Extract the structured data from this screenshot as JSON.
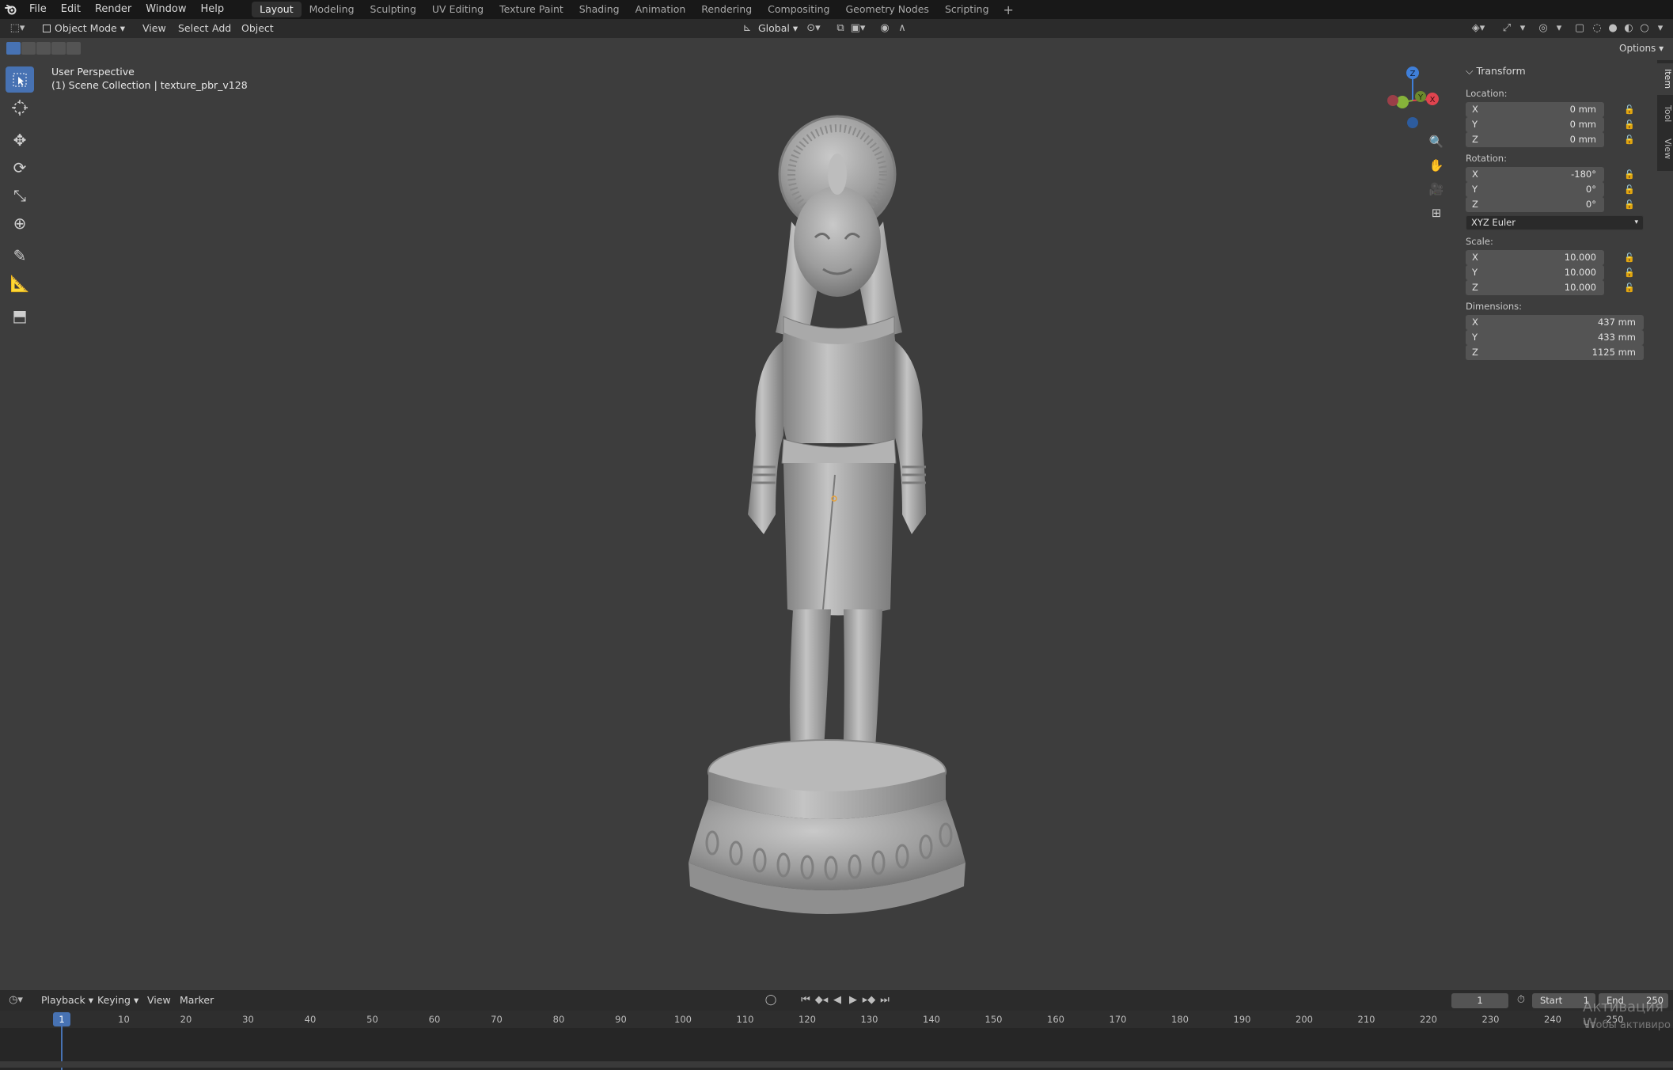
{
  "menu": {
    "items": [
      "File",
      "Edit",
      "Render",
      "Window",
      "Help"
    ]
  },
  "workspaces": {
    "tabs": [
      "Layout",
      "Modeling",
      "Sculpting",
      "UV Editing",
      "Texture Paint",
      "Shading",
      "Animation",
      "Rendering",
      "Compositing",
      "Geometry Nodes",
      "Scripting"
    ],
    "active": "Layout"
  },
  "header": {
    "mode": "Object Mode",
    "menus": [
      "View",
      "Select",
      "Add",
      "Object"
    ],
    "orientation": "Global",
    "options_label": "Options"
  },
  "viewport": {
    "view_name": "User Perspective",
    "collection": "(1) Scene Collection | texture_pbr_v128"
  },
  "gizmo": {
    "axes": [
      "Z",
      "Y",
      "X"
    ]
  },
  "npanel": {
    "section": "Transform",
    "location_label": "Location:",
    "location": [
      {
        "axis": "X",
        "value": "0 mm"
      },
      {
        "axis": "Y",
        "value": "0 mm"
      },
      {
        "axis": "Z",
        "value": "0 mm"
      }
    ],
    "rotation_label": "Rotation:",
    "rotation": [
      {
        "axis": "X",
        "value": "-180°"
      },
      {
        "axis": "Y",
        "value": "0°"
      },
      {
        "axis": "Z",
        "value": "0°"
      }
    ],
    "rotation_mode": "XYZ Euler",
    "scale_label": "Scale:",
    "scale": [
      {
        "axis": "X",
        "value": "10.000"
      },
      {
        "axis": "Y",
        "value": "10.000"
      },
      {
        "axis": "Z",
        "value": "10.000"
      }
    ],
    "dimensions_label": "Dimensions:",
    "dimensions": [
      {
        "axis": "X",
        "value": "437 mm"
      },
      {
        "axis": "Y",
        "value": "433 mm"
      },
      {
        "axis": "Z",
        "value": "1125 mm"
      }
    ],
    "side_tabs": [
      "Item",
      "Tool",
      "View"
    ]
  },
  "timeline": {
    "menus": [
      "Playback",
      "Keying",
      "View",
      "Marker"
    ],
    "current_frame": "1",
    "start_label": "Start",
    "start": "1",
    "end_label": "End",
    "end": "250",
    "ticks": [
      "10",
      "20",
      "30",
      "40",
      "50",
      "60",
      "70",
      "80",
      "90",
      "100",
      "110",
      "120",
      "130",
      "140",
      "150",
      "160",
      "170",
      "180",
      "190",
      "200",
      "210",
      "220",
      "230",
      "240",
      "250"
    ],
    "playhead": "1"
  },
  "watermark": {
    "line1": "Активация W",
    "line2": "Чтобы активиро"
  },
  "colors": {
    "accent": "#4772b3",
    "axis_x": "#e0444f",
    "axis_y": "#86b33a",
    "axis_z": "#3f7fd9",
    "viewport_bg": "#3d3d3d"
  }
}
